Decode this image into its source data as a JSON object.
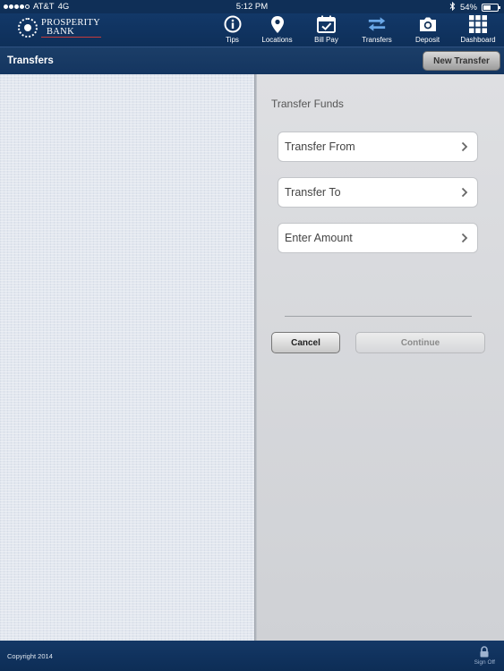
{
  "status": {
    "carrier": "AT&T",
    "network": "4G",
    "time": "5:12 PM",
    "battery": "54%",
    "battery_level": 0.54,
    "signal_bars": 4
  },
  "brand": {
    "line1": "PROSPERITY",
    "line2": "BANK"
  },
  "nav": {
    "items": [
      {
        "label": "Tips",
        "icon": "info-icon"
      },
      {
        "label": "Locations",
        "icon": "location-pin-icon"
      },
      {
        "label": "Bill Pay",
        "icon": "calendar-check-icon"
      },
      {
        "label": "Transfers",
        "icon": "transfer-arrows-icon"
      },
      {
        "label": "Deposit",
        "icon": "camera-icon"
      },
      {
        "label": "Dashboard",
        "icon": "grid-icon"
      }
    ]
  },
  "header": {
    "title": "Transfers",
    "new_transfer_label": "New Transfer"
  },
  "form": {
    "section_title": "Transfer Funds",
    "rows": [
      {
        "label": "Transfer From"
      },
      {
        "label": "Transfer To"
      },
      {
        "label": "Enter Amount"
      }
    ],
    "cancel_label": "Cancel",
    "continue_label": "Continue"
  },
  "footer": {
    "copyright": "Copyright 2014",
    "signoff_label": "Sign Off"
  },
  "colors": {
    "nav_bg": "#0f2f57",
    "accent_transfer": "#5aa0e6"
  }
}
